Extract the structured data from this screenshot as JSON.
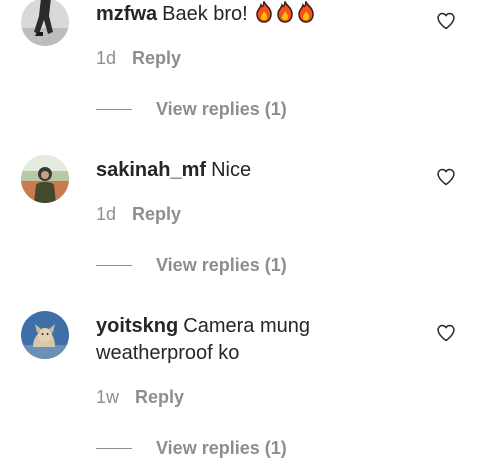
{
  "comments": [
    {
      "username": "mzfwa",
      "text": "Baek bro!",
      "emoji": [
        "fire",
        "fire",
        "fire"
      ],
      "time": "1d",
      "reply_label": "Reply",
      "view_replies_label": "View replies (1)",
      "like_icon": "heart-outline-icon"
    },
    {
      "username": "sakinah_mf",
      "text": "Nice",
      "time": "1d",
      "reply_label": "Reply",
      "view_replies_label": "View replies (1)",
      "like_icon": "heart-outline-icon"
    },
    {
      "username": "yoitskng",
      "text": "Camera mung weatherproof ko",
      "time": "1w",
      "reply_label": "Reply",
      "view_replies_label": "View replies (1)",
      "like_icon": "heart-outline-icon"
    }
  ],
  "colors": {
    "primary_text": "#262626",
    "secondary_text": "#8e8e8e",
    "background": "#ffffff"
  }
}
